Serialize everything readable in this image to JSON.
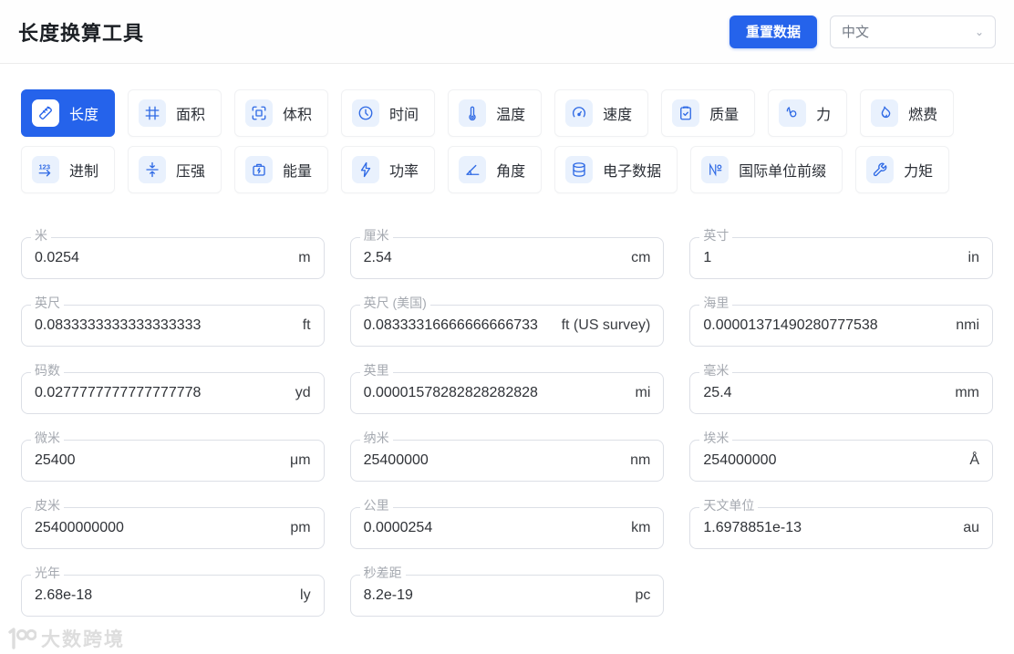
{
  "header": {
    "title": "长度换算工具",
    "reset_button": "重置数据",
    "language_selected": "中文"
  },
  "colors": {
    "primary_blue": "#2563eb",
    "chip_bg": "#e9f1fd",
    "chip_icon": "#2f6ae5",
    "field_border": "#dcdfe6",
    "label_gray": "#a5a9b0"
  },
  "tabs": [
    {
      "label": "长度",
      "icon": "ruler-icon",
      "selected": true
    },
    {
      "label": "面积",
      "icon": "grid-icon",
      "selected": false
    },
    {
      "label": "体积",
      "icon": "cube-brackets-icon",
      "selected": false
    },
    {
      "label": "时间",
      "icon": "clock-icon",
      "selected": false
    },
    {
      "label": "温度",
      "icon": "thermometer-icon",
      "selected": false
    },
    {
      "label": "速度",
      "icon": "speedometer-icon",
      "selected": false
    },
    {
      "label": "质量",
      "icon": "clipboard-check-icon",
      "selected": false
    },
    {
      "label": "力",
      "icon": "muscle-icon",
      "selected": false
    },
    {
      "label": "燃费",
      "icon": "flame-icon",
      "selected": false
    },
    {
      "label": "进制",
      "icon": "numbers-arrow-icon",
      "selected": false
    },
    {
      "label": "压强",
      "icon": "compress-icon",
      "selected": false
    },
    {
      "label": "能量",
      "icon": "battery-bolt-icon",
      "selected": false
    },
    {
      "label": "功率",
      "icon": "lightning-icon",
      "selected": false
    },
    {
      "label": "角度",
      "icon": "angle-icon",
      "selected": false
    },
    {
      "label": "电子数据",
      "icon": "database-icon",
      "selected": false
    },
    {
      "label": "国际单位前缀",
      "icon": "numero-icon",
      "selected": false
    },
    {
      "label": "力矩",
      "icon": "wrench-icon",
      "selected": false
    }
  ],
  "fields": [
    {
      "label": "米",
      "value": "0.0254",
      "unit": "m"
    },
    {
      "label": "厘米",
      "value": "2.54",
      "unit": "cm"
    },
    {
      "label": "英寸",
      "value": "1",
      "unit": "in"
    },
    {
      "label": "英尺",
      "value": "0.0833333333333333333",
      "unit": "ft"
    },
    {
      "label": "英尺 (美国)",
      "value": "0.08333316666666666733",
      "unit": "ft (US survey)"
    },
    {
      "label": "海里",
      "value": "0.00001371490280777538",
      "unit": "nmi"
    },
    {
      "label": "码数",
      "value": "0.0277777777777777778",
      "unit": "yd"
    },
    {
      "label": "英里",
      "value": "0.00001578282828282828",
      "unit": "mi"
    },
    {
      "label": "毫米",
      "value": "25.4",
      "unit": "mm"
    },
    {
      "label": "微米",
      "value": "25400",
      "unit": "μm"
    },
    {
      "label": "纳米",
      "value": "25400000",
      "unit": "nm"
    },
    {
      "label": "埃米",
      "value": "254000000",
      "unit": "Å"
    },
    {
      "label": "皮米",
      "value": "25400000000",
      "unit": "pm"
    },
    {
      "label": "公里",
      "value": "0.0000254",
      "unit": "km"
    },
    {
      "label": "天文单位",
      "value": "1.6978851e-13",
      "unit": "au"
    },
    {
      "label": "光年",
      "value": "2.68e-18",
      "unit": "ly"
    },
    {
      "label": "秒差距",
      "value": "8.2e-19",
      "unit": "pc"
    }
  ],
  "watermark": {
    "text": "大数跨境"
  }
}
